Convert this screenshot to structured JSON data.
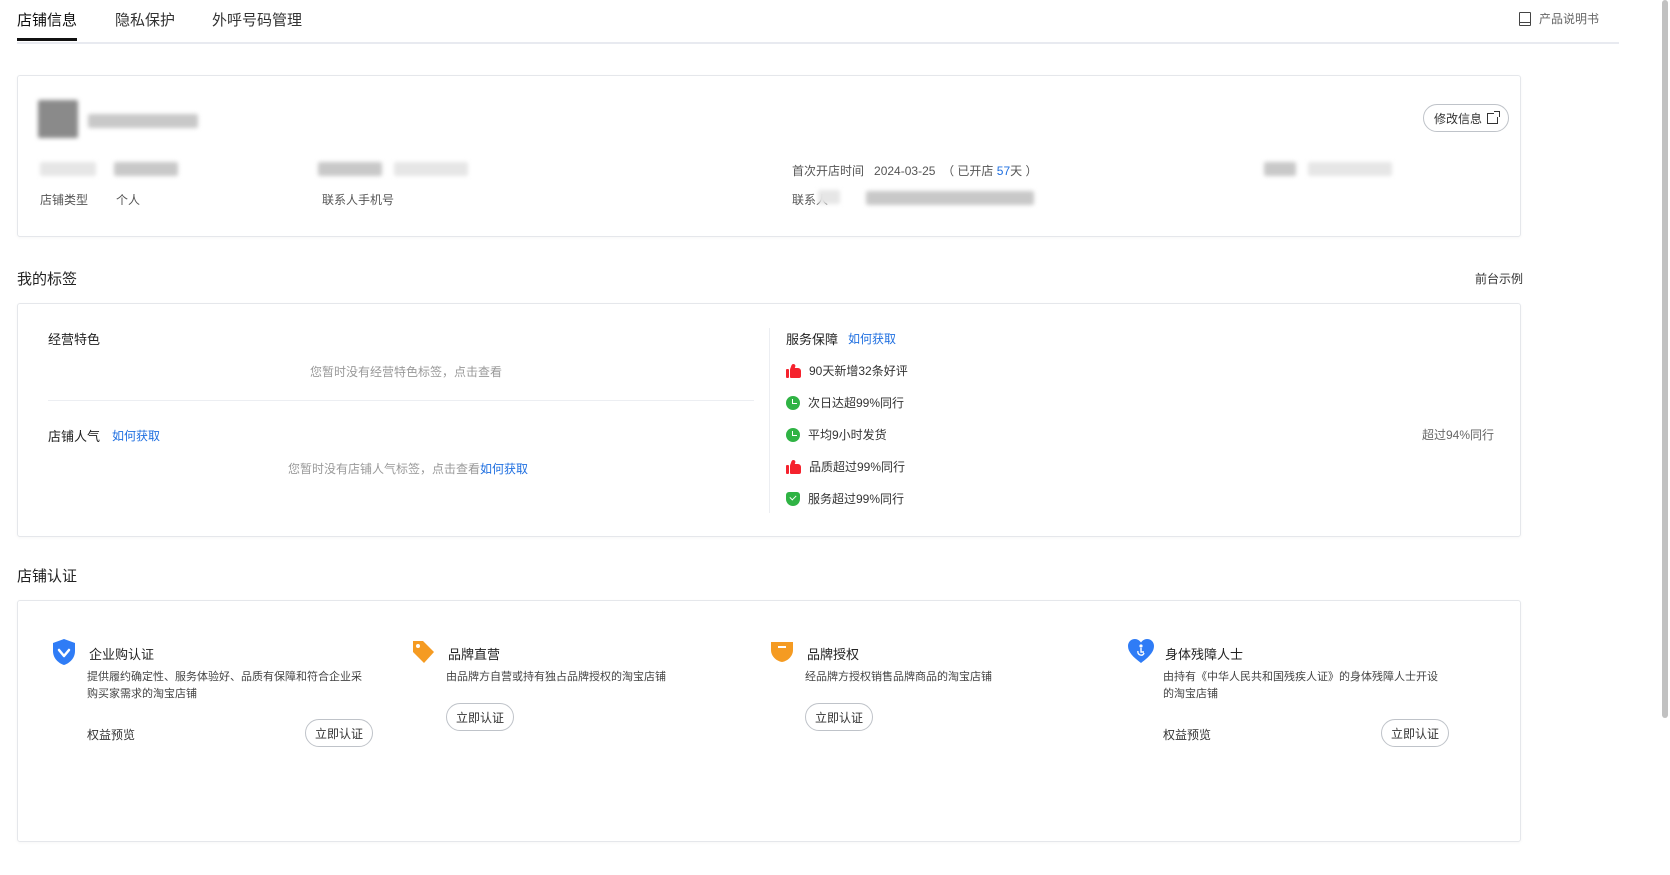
{
  "tabs": [
    {
      "label": "店铺信息"
    },
    {
      "label": "隐私保护"
    },
    {
      "label": "外呼号码管理"
    }
  ],
  "header": {
    "manual": "产品说明书"
  },
  "shop": {
    "edit_btn": "修改信息",
    "type_label": "店铺类型",
    "type_value": "个人",
    "phone_label": "联系人手机号",
    "open_label": "首次开店时间",
    "open_date": "2024-03-25",
    "open_prefix": "（ 已开店 ",
    "open_days": "57",
    "open_suffix": "天 ）",
    "contact_label": "联系人"
  },
  "tags": {
    "title": "我的标签",
    "example": "前台示例",
    "feature_title": "经营特色",
    "feature_empty": "您暂时没有经营特色标签，点击查看",
    "popularity_title": "店铺人气",
    "how_to_get": "如何获取",
    "popularity_empty": "您暂时没有店铺人气标签，点击查看",
    "service_title": "服务保障",
    "service_items": [
      {
        "icon": "thumb-up-icon",
        "text": "90天新增32条好评"
      },
      {
        "icon": "clock-icon",
        "text": "次日达超99%同行"
      },
      {
        "icon": "clock-icon",
        "text": "平均9小时发货",
        "right": "超过94%同行"
      },
      {
        "icon": "thumb-up-icon",
        "text": "品质超过99%同行"
      },
      {
        "icon": "shield-check-icon",
        "text": "服务超过99%同行"
      }
    ]
  },
  "certs": {
    "title": "店铺认证",
    "items": [
      {
        "name": "企业购认证",
        "desc1": "提供履约确定性、服务体验好、品质有保障和符合企业采",
        "desc2": "购买家需求的淘宝店铺",
        "benefit": "权益预览",
        "button": "立即认证"
      },
      {
        "name": "品牌直营",
        "desc1": "由品牌方自营或持有独占品牌授权的淘宝店铺",
        "desc2": "",
        "benefit": "",
        "button": "立即认证"
      },
      {
        "name": "品牌授权",
        "desc1": "经品牌方授权销售品牌商品的淘宝店铺",
        "desc2": "",
        "benefit": "",
        "button": "立即认证"
      },
      {
        "name": "身体残障人士",
        "desc1": "由持有《中华人民共和国残疾人证》的身体残障人士开设",
        "desc2": "的淘宝店铺",
        "benefit": "权益预览",
        "button": "立即认证"
      }
    ]
  },
  "colors": {
    "link": "#1f6fe0",
    "thumb": "#f5222d",
    "green": "#2fb344",
    "blue_shield": "#2f7cf6",
    "orange": "#f59b22"
  }
}
